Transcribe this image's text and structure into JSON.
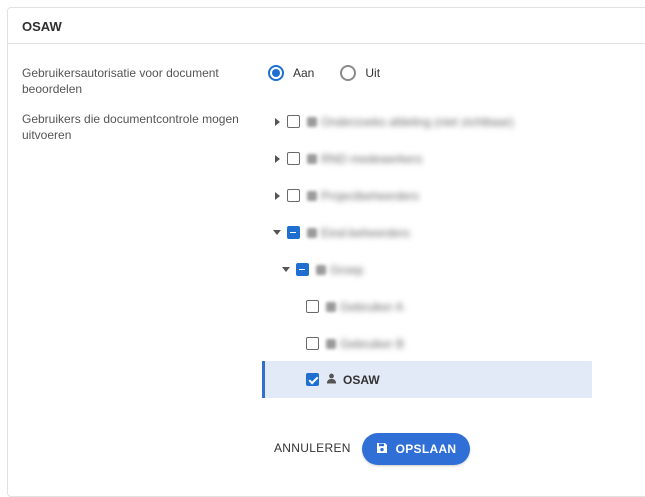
{
  "card": {
    "title": "OSAW"
  },
  "fields": {
    "review_label": "Gebruikersautorisatie voor document beoordelen",
    "users_label": "Gebruikers die documentcontrole mogen uitvoeren"
  },
  "radio": {
    "on_label": "Aan",
    "off_label": "Uit",
    "selected": "Aan"
  },
  "tree": {
    "nodes": [
      {
        "label": "Onderzoeks afdeling (niet zichtbaar)",
        "state": "unchecked",
        "expanded": false
      },
      {
        "label": "RND medewerkers",
        "state": "unchecked",
        "expanded": false
      },
      {
        "label": "Projectbeheerders",
        "state": "unchecked",
        "expanded": false
      },
      {
        "label": "Eind-beheerders",
        "state": "indeterminate",
        "expanded": true
      },
      {
        "label": "Groep",
        "state": "indeterminate",
        "expanded": true
      },
      {
        "label": "Gebruiker A",
        "state": "unchecked"
      },
      {
        "label": "Gebruiker B",
        "state": "unchecked"
      },
      {
        "label": "OSAW",
        "state": "checked",
        "selected": true
      }
    ]
  },
  "actions": {
    "cancel_label": "ANNULEREN",
    "save_label": "OPSLAAN"
  },
  "colors": {
    "accent": "#2f6fd6",
    "selected_row": "#e3eaf7"
  }
}
